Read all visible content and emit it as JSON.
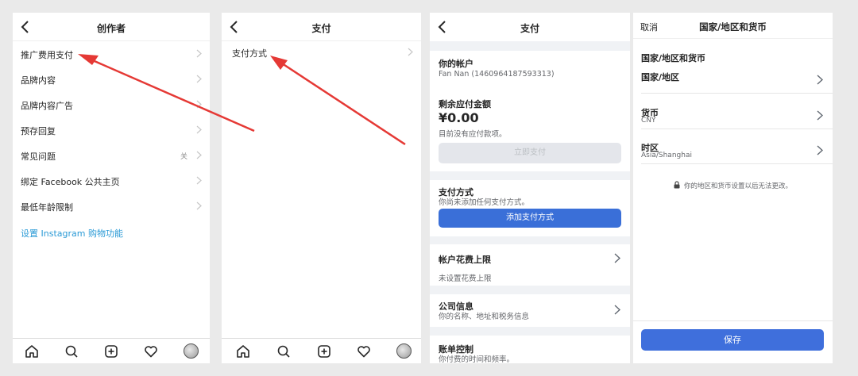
{
  "panel1": {
    "title": "创作者",
    "items": [
      {
        "label": "推广费用支付"
      },
      {
        "label": "品牌内容"
      },
      {
        "label": "品牌内容广告"
      },
      {
        "label": "预存回复"
      },
      {
        "label": "常见问题",
        "status": "关"
      },
      {
        "label": "绑定 Facebook 公共主页"
      },
      {
        "label": "最低年龄限制"
      }
    ],
    "link": "设置 Instagram 购物功能",
    "tabs": [
      "home-icon",
      "search-icon",
      "add-icon",
      "heart-icon",
      "profile-avatar"
    ]
  },
  "panel2": {
    "title": "支付",
    "items": [
      {
        "label": "支付方式"
      }
    ],
    "tabs": [
      "home-icon",
      "search-icon",
      "add-icon",
      "heart-icon",
      "profile-avatar"
    ]
  },
  "panel3": {
    "title": "支付",
    "account": {
      "heading": "你的帐户",
      "sub": "Fan Nan (1460964187593313)"
    },
    "balance": {
      "heading": "剩余应付金额",
      "amount": "¥0.00",
      "note": "目前没有应付款项。",
      "button": "立即支付"
    },
    "payment": {
      "heading": "支付方式",
      "sub": "你尚未添加任何支付方式。",
      "button": "添加支付方式"
    },
    "limit": {
      "heading": "帐户花费上限",
      "sub": "未设置花费上限"
    },
    "company": {
      "heading": "公司信息",
      "sub": "你的名称、地址和税务信息"
    },
    "billing": {
      "heading": "账单控制",
      "sub": "你付费的时间和频率。"
    }
  },
  "panel4": {
    "cancel": "取消",
    "title": "国家/地区和货币",
    "section": "国家/地区和货币",
    "rows": [
      {
        "label": "国家/地区",
        "value": ""
      },
      {
        "label": "货币",
        "value": "CNY"
      },
      {
        "label": "时区",
        "value": "Asia/Shanghai"
      }
    ],
    "note": "你的地区和货币设置以后无法更改。",
    "save": "保存"
  },
  "colors": {
    "accent": "#3a6fd8",
    "link": "#2a9ad6",
    "annotation": "#e53935"
  }
}
